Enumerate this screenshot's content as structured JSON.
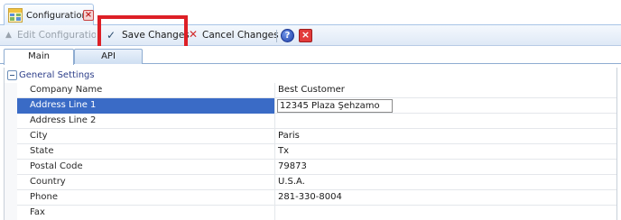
{
  "document_tab": {
    "title": "Configuration",
    "icon": "config-grid-icon",
    "close_icon": "close-tab-icon"
  },
  "toolbar": {
    "edit_label": "Edit Configuration",
    "save_label": "Save Changes",
    "cancel_label": "Cancel Changes",
    "help_icon": "help-icon",
    "close_icon": "close-icon"
  },
  "subtabs": [
    "Main",
    "API"
  ],
  "section": {
    "title": "General Settings"
  },
  "properties": [
    {
      "name": "Company Name",
      "value": "Best Customer"
    },
    {
      "name": "Address Line 1",
      "value": "12345 Plaza Şehzamo"
    },
    {
      "name": "Address Line 2",
      "value": ""
    },
    {
      "name": "City",
      "value": "Paris"
    },
    {
      "name": "State",
      "value": "Tx"
    },
    {
      "name": "Postal Code",
      "value": "79873"
    },
    {
      "name": "Country",
      "value": "U.S.A."
    },
    {
      "name": "Phone",
      "value": "281-330-8004"
    },
    {
      "name": "Fax",
      "value": ""
    }
  ],
  "colors": {
    "highlight": "#dd1f26",
    "selection": "#3a6bc6",
    "section_title": "#2e3f8a"
  }
}
